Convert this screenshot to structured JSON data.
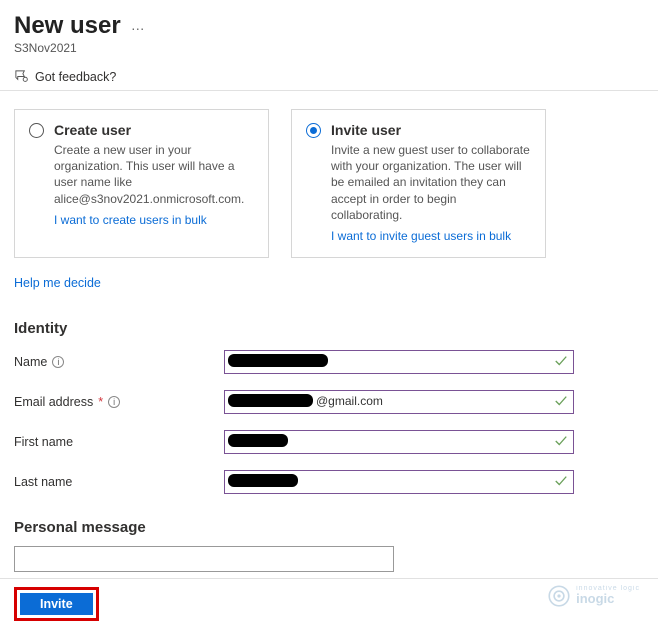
{
  "header": {
    "title": "New user",
    "subtitle": "S3Nov2021",
    "more_symbol": "…"
  },
  "feedback": {
    "label": "Got feedback?"
  },
  "cards": {
    "create": {
      "title": "Create user",
      "desc": "Create a new user in your organization. This user will have a user name like alice@s3nov2021.onmicrosoft.com.",
      "link": "I want to create users in bulk"
    },
    "invite": {
      "title": "Invite user",
      "desc": "Invite a new guest user to collaborate with your organization. The user will be emailed an invitation they can accept in order to begin collaborating.",
      "link": "I want to invite guest users in bulk"
    }
  },
  "help_link": "Help me decide",
  "identity": {
    "heading": "Identity",
    "name_label": "Name",
    "email_label": "Email address",
    "email_suffix": "@gmail.com",
    "first_label": "First name",
    "last_label": "Last name"
  },
  "personal_message": {
    "heading": "Personal message"
  },
  "actions": {
    "invite": "Invite"
  },
  "watermark": {
    "brand": "inogic",
    "tagline": "innovative logic"
  }
}
